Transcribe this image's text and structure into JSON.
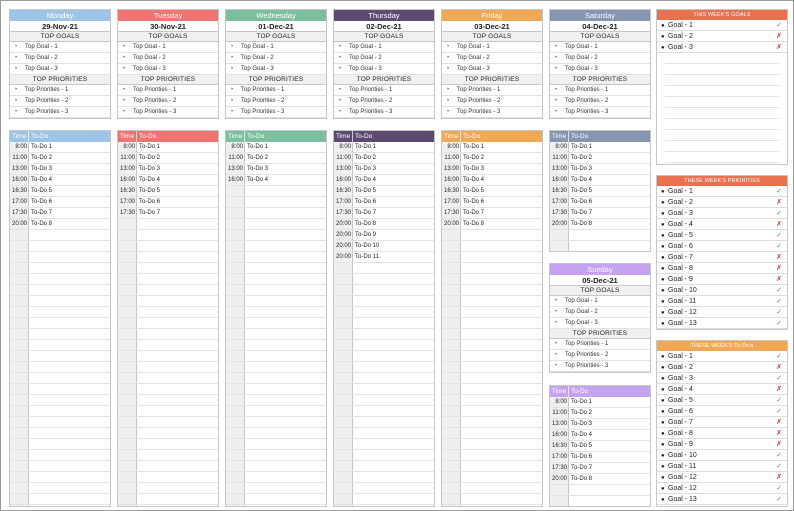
{
  "days": [
    {
      "name": "Monday",
      "date": "29-Nov-21",
      "color": "#9dc3e6",
      "goals_title": "TOP GOALS",
      "goals": [
        "Top Goal - 1",
        "Top Goal - 2",
        "Top Goal - 3"
      ],
      "prio_title": "TOP PRIORITIES",
      "priorities": [
        "Top Priorities - 1",
        "Top Priorities - 2",
        "Top Priorities - 3"
      ]
    },
    {
      "name": "Tuesday",
      "date": "30-Nov-21",
      "color": "#f07472",
      "goals_title": "TOP GOALS",
      "goals": [
        "Top Goal - 1",
        "Top Goal - 2",
        "Top Goal - 3"
      ],
      "prio_title": "TOP PRIORITIES",
      "priorities": [
        "Top Priorities - 1",
        "Top Priorities - 2",
        "Top Priorities - 3"
      ]
    },
    {
      "name": "Wednesday",
      "date": "01-Dec-21",
      "color": "#7bbf9f",
      "goals_title": "TOP GOALS",
      "goals": [
        "Top Goal - 1",
        "Top Goal - 2",
        "Top Goal - 3"
      ],
      "prio_title": "TOP PRIORITIES",
      "priorities": [
        "Top Priorities - 1",
        "Top Priorities - 2",
        "Top Priorities - 3"
      ]
    },
    {
      "name": "Thursday",
      "date": "02-Dec-21",
      "color": "#5c4a72",
      "goals_title": "TOP GOALS",
      "goals": [
        "Top Goal - 1",
        "Top Goal - 2",
        "Top Goal - 3"
      ],
      "prio_title": "TOP PRIORITIES",
      "priorities": [
        "Top Priorities - 1",
        "Top Priorities - 2",
        "Top Priorities - 3"
      ]
    },
    {
      "name": "Friday",
      "date": "03-Dec-21",
      "color": "#f0a756",
      "goals_title": "TOP GOALS",
      "goals": [
        "Top Goal - 1",
        "Top Goal - 2",
        "Top Goal - 3"
      ],
      "prio_title": "TOP PRIORITIES",
      "priorities": [
        "Top Priorities - 1",
        "Top Priorities - 2",
        "Top Priorities - 3"
      ]
    },
    {
      "name": "Saturday",
      "date": "04-Dec-21",
      "color": "#8496b0",
      "goals_title": "TOP GOALS",
      "goals": [
        "Top Goal - 1",
        "Top Goal - 2",
        "Top Goal - 3"
      ],
      "prio_title": "TOP PRIORITIES",
      "priorities": [
        "Top Priorities - 1",
        "Top Priorities - 2",
        "Top Priorities - 3"
      ]
    },
    {
      "name": "Sunday",
      "date": "05-Dec-21",
      "color": "#c5a3f0",
      "goals_title": "TOP GOALS",
      "goals": [
        "Top Goal - 1",
        "Top Goal - 2",
        "Top Goal - 3"
      ],
      "prio_title": "TOP PRIORITIES",
      "priorities": [
        "Top Priorities - 1",
        "Top Priorities - 2",
        "Top Priorities - 3"
      ]
    }
  ],
  "schedule_header": {
    "time": "Time",
    "todo": "To-Do"
  },
  "schedules": [
    [
      [
        "8:00",
        "To-Do 1"
      ],
      [
        "11:00",
        "To-Do 2"
      ],
      [
        "13:00",
        "To-Do 3"
      ],
      [
        "16:00",
        "To-Do 4"
      ],
      [
        "16:30",
        "To-Do 5"
      ],
      [
        "17:00",
        "To-Do 6"
      ],
      [
        "17:30",
        "To-Do 7"
      ],
      [
        "20:00",
        "To-Do 8"
      ]
    ],
    [
      [
        "8:00",
        "To-Do 1"
      ],
      [
        "11:00",
        "To-Do 2"
      ],
      [
        "13:00",
        "To-Do 3"
      ],
      [
        "16:00",
        "To-Do 4"
      ],
      [
        "16:30",
        "To-Do 5"
      ],
      [
        "17:00",
        "To-Do 6"
      ],
      [
        "17:30",
        "To-Do 7"
      ]
    ],
    [
      [
        "8:00",
        "To-Do 1"
      ],
      [
        "11:00",
        "To-Do 2"
      ],
      [
        "13:00",
        "To-Do 3"
      ],
      [
        "16:00",
        "To-Do 4"
      ]
    ],
    [
      [
        "8:00",
        "To-Do 1"
      ],
      [
        "11:00",
        "To-Do 2"
      ],
      [
        "13:00",
        "To-Do 3"
      ],
      [
        "16:00",
        "To-Do 4"
      ],
      [
        "16:30",
        "To-Do 5"
      ],
      [
        "17:00",
        "To-Do 6"
      ],
      [
        "17:30",
        "To-Do 7"
      ],
      [
        "20:00",
        "To-Do 8"
      ],
      [
        "20:00",
        "To-Do 9"
      ],
      [
        "20:00",
        "To-Do 10"
      ],
      [
        "20:00",
        "To-Do 11"
      ]
    ],
    [
      [
        "8:00",
        "To-Do 1"
      ],
      [
        "11:00",
        "To-Do 2"
      ],
      [
        "13:00",
        "To-Do 3"
      ],
      [
        "16:00",
        "To-Do 4"
      ],
      [
        "16:30",
        "To-Do 5"
      ],
      [
        "17:00",
        "To-Do 6"
      ],
      [
        "17:30",
        "To-Do 7"
      ],
      [
        "20:00",
        "To-Do 8"
      ]
    ],
    [
      [
        "8:00",
        "To-Do 1"
      ],
      [
        "11:00",
        "To-Do 2"
      ],
      [
        "13:00",
        "To-Do 3"
      ],
      [
        "16:00",
        "To-Do 4"
      ],
      [
        "16:30",
        "To-Do 5"
      ],
      [
        "17:00",
        "To-Do 6"
      ],
      [
        "17:30",
        "To-Do 7"
      ],
      [
        "20:00",
        "To-Do 8"
      ]
    ],
    [
      [
        "8:00",
        "To-Do 1"
      ],
      [
        "11:00",
        "To-Do 2"
      ],
      [
        "13:00",
        "To-Do 3"
      ],
      [
        "16:00",
        "To-Do 4"
      ],
      [
        "16:30",
        "To-Do 5"
      ],
      [
        "17:00",
        "To-Do 6"
      ],
      [
        "17:30",
        "To-Do 7"
      ],
      [
        "20:00",
        "To-Do 8"
      ]
    ]
  ],
  "week_goals": {
    "title": "THIS WEEK'S GOALS",
    "color": "#e8714f",
    "items": [
      {
        "label": "Goal - 1",
        "done": true
      },
      {
        "label": "Goal - 2",
        "done": false
      },
      {
        "label": "Goal - 3",
        "done": false
      }
    ]
  },
  "week_priorities": {
    "title": "THESE WEEK'S PRIORITIES",
    "color": "#e8714f",
    "items": [
      {
        "label": "Goal - 1",
        "done": true
      },
      {
        "label": "Goal - 2",
        "done": false
      },
      {
        "label": "Goal - 3",
        "done": true
      },
      {
        "label": "Goal - 4",
        "done": false
      },
      {
        "label": "Goal - 5",
        "done": true
      },
      {
        "label": "Goal - 6",
        "done": true
      },
      {
        "label": "Goal - 7",
        "done": false
      },
      {
        "label": "Goal - 8",
        "done": false
      },
      {
        "label": "Goal - 9",
        "done": false
      },
      {
        "label": "Goal - 10",
        "done": true
      },
      {
        "label": "Goal - 11",
        "done": true
      },
      {
        "label": "Goal - 12",
        "done": true
      },
      {
        "label": "Goal - 13",
        "done": true
      }
    ]
  },
  "week_todos": {
    "title": "THESE WEEK'S To-Do's",
    "color": "#f0a756",
    "items": [
      {
        "label": "Goal - 1",
        "done": true
      },
      {
        "label": "Goal - 2",
        "done": false
      },
      {
        "label": "Goal - 3",
        "done": true
      },
      {
        "label": "Goal - 4",
        "done": false
      },
      {
        "label": "Goal - 5",
        "done": true
      },
      {
        "label": "Goal - 6",
        "done": true
      },
      {
        "label": "Goal - 7",
        "done": false
      },
      {
        "label": "Goal - 8",
        "done": false
      },
      {
        "label": "Goal - 9",
        "done": false
      },
      {
        "label": "Goal - 10",
        "done": true
      },
      {
        "label": "Goal - 11",
        "done": true
      },
      {
        "label": "Goal - 12",
        "done": false
      },
      {
        "label": "Goal - 12",
        "done": true
      },
      {
        "label": "Goal - 13",
        "done": true
      }
    ]
  },
  "icons": {
    "bullet": "circle-bullet-icon",
    "done": "check-icon",
    "not_done": "cross-icon"
  }
}
